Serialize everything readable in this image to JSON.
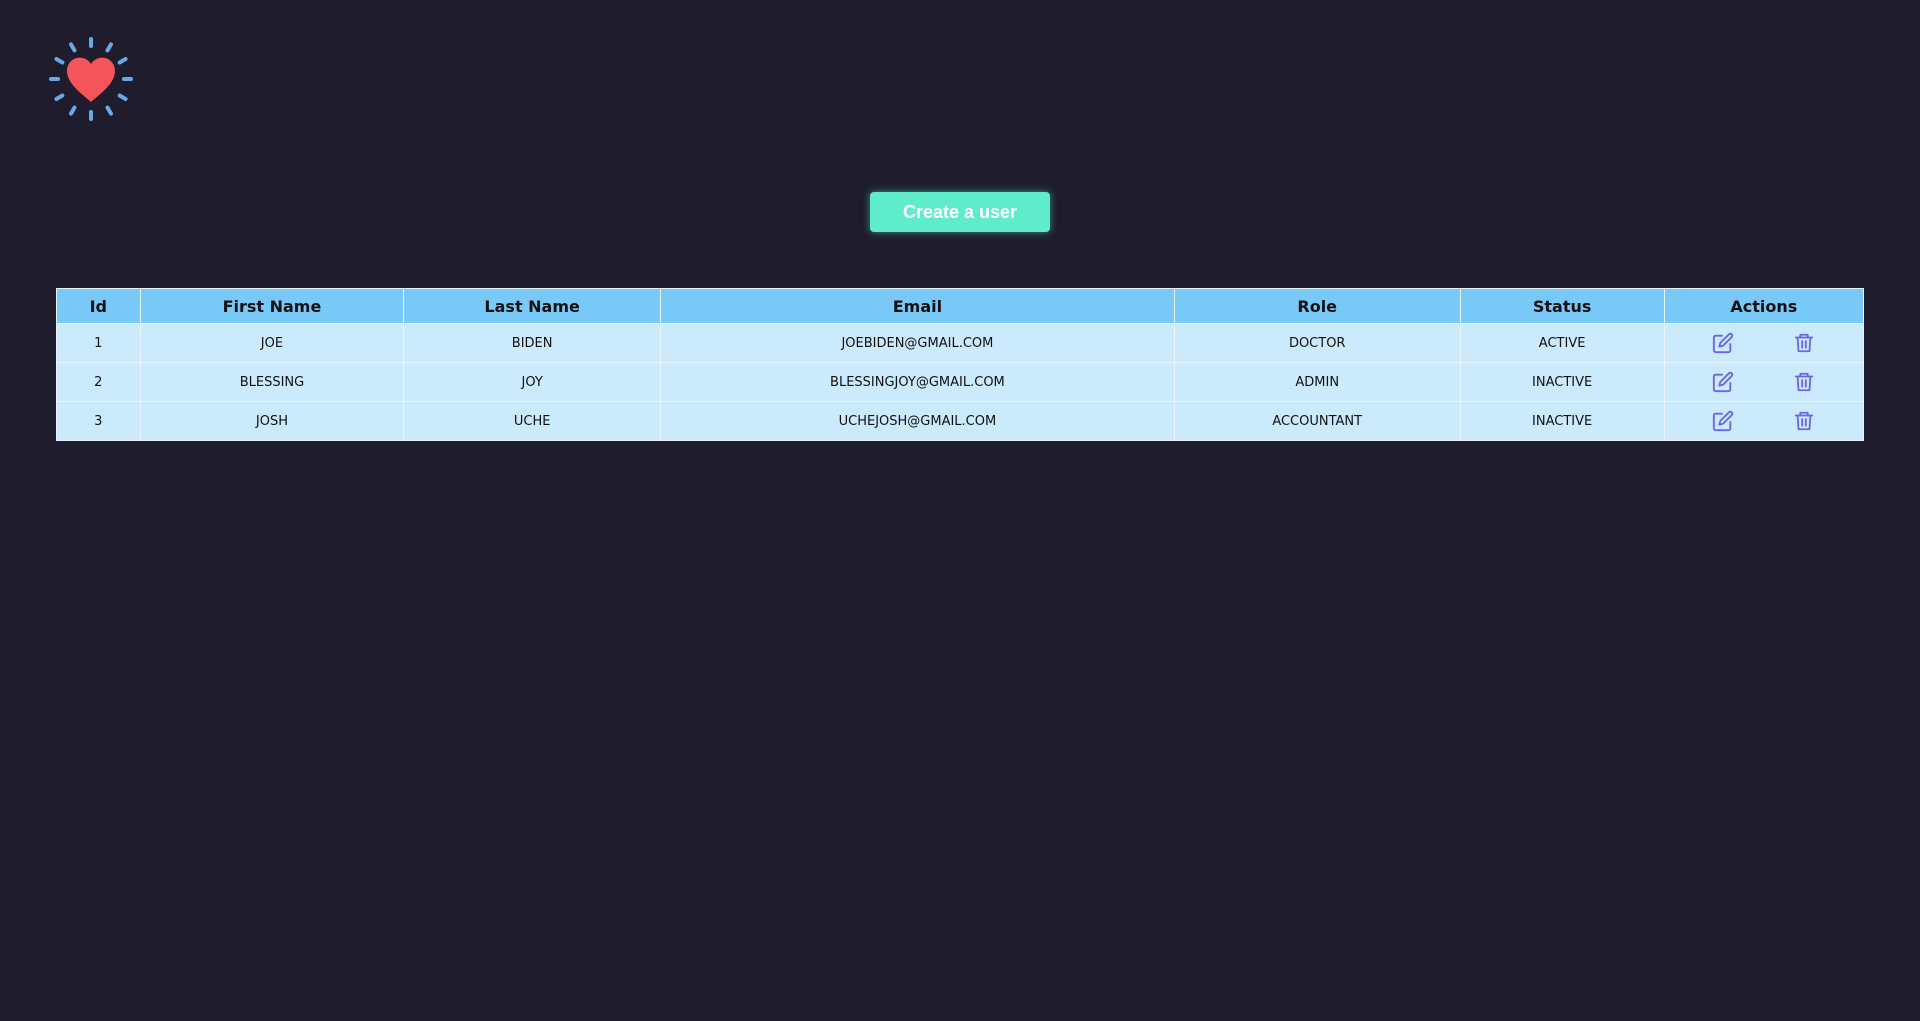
{
  "header": {
    "logo_icon": "heart-burst-icon"
  },
  "toolbar": {
    "create_label": "Create a user"
  },
  "table": {
    "columns": [
      "Id",
      "First Name",
      "Last Name",
      "Email",
      "Role",
      "Status",
      "Actions"
    ],
    "rows": [
      {
        "id": "1",
        "first_name": "JOE",
        "last_name": "BIDEN",
        "email": "JOEBIDEN@GMAIL.COM",
        "role": "DOCTOR",
        "status": "ACTIVE"
      },
      {
        "id": "2",
        "first_name": "BLESSING",
        "last_name": "JOY",
        "email": "BLESSINGJOY@GMAIL.COM",
        "role": "ADMIN",
        "status": "INACTIVE"
      },
      {
        "id": "3",
        "first_name": "JOSH",
        "last_name": "UCHE",
        "email": "UCHEJOSH@GMAIL.COM",
        "role": "ACCOUNTANT",
        "status": "INACTIVE"
      }
    ],
    "action_icons": {
      "edit": "edit-icon",
      "delete": "trash-icon"
    }
  },
  "colors": {
    "background": "#1e1c2d",
    "accent_button": "#5eeccb",
    "table_header": "#78c9f8",
    "table_row": "#cbeafc",
    "icon": "#6d63e6",
    "heart": "#f4545a",
    "rays": "#6aa8e8"
  }
}
